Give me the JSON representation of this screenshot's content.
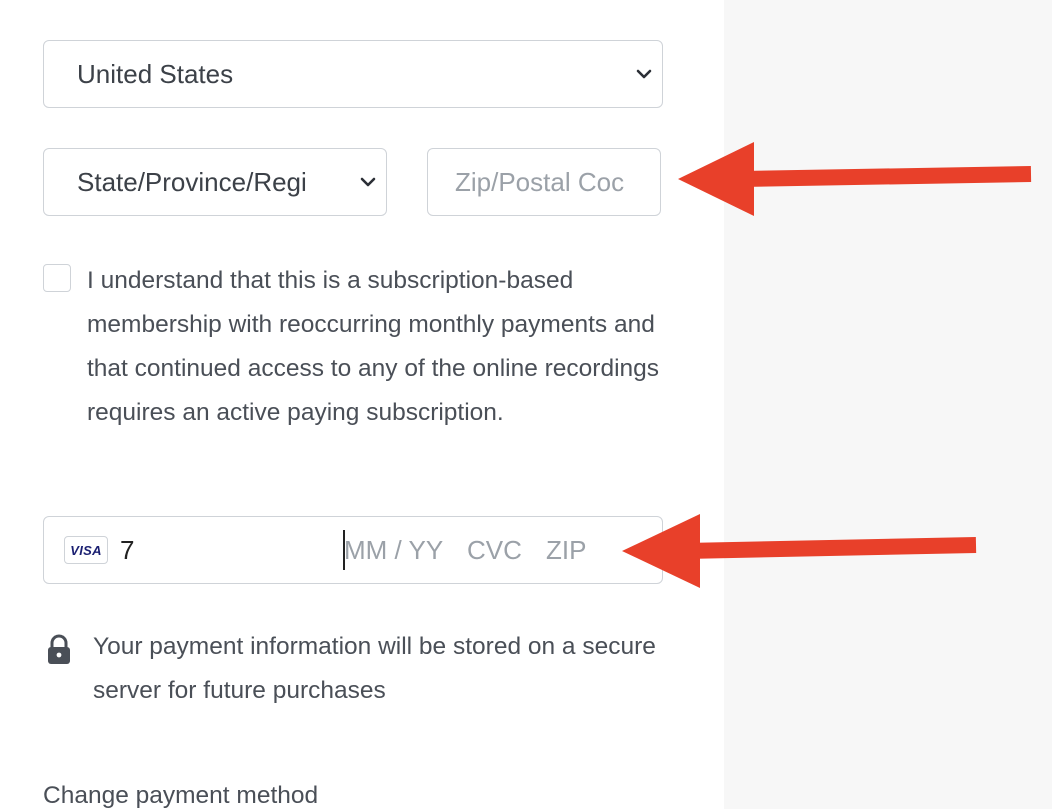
{
  "billing": {
    "country": {
      "value": "United States"
    },
    "state": {
      "value": "State/Province/Regi"
    },
    "zip": {
      "placeholder": "Zip/Postal Coc"
    }
  },
  "consent": {
    "checked": false,
    "text": "I understand that this is a subscription-based membership with reoccurring monthly payments and that continued access to any of the online recordings requires an active paying subscription."
  },
  "card": {
    "brand": "VISA",
    "number_value": "7",
    "expiry_placeholder": "MM / YY",
    "cvc_placeholder": "CVC",
    "zip_placeholder": "ZIP"
  },
  "secure_note": "Your payment information will be stored on a secure server for future purchases",
  "change_payment_label": "Change payment method",
  "icons": {
    "chevron": "chevron-down-icon",
    "lock": "lock-icon",
    "arrow": "arrow-left-icon"
  },
  "colors": {
    "annotation_arrow": "#e8402a",
    "border": "#cfd3d8",
    "text": "#4a4f57",
    "placeholder": "#9ba1a8",
    "right_panel": "#f7f7f7"
  }
}
